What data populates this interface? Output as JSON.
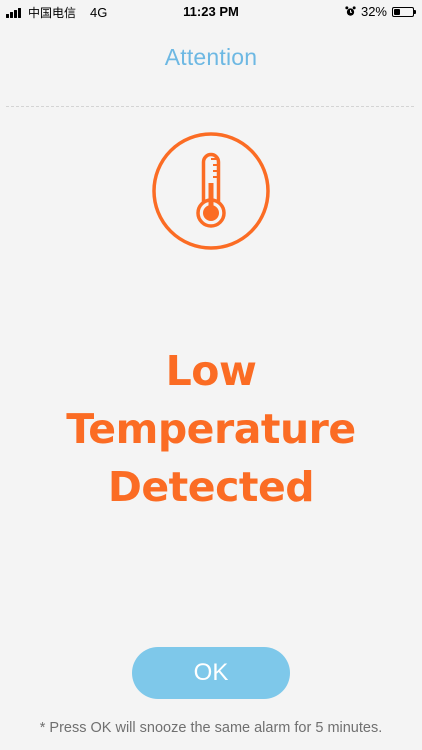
{
  "status_bar": {
    "carrier": "中国电信",
    "network": "4G",
    "time": "11:23 PM",
    "battery_percent": "32%",
    "battery_level": 0.32
  },
  "header": {
    "title": "Attention"
  },
  "alert": {
    "icon": "thermometer-icon",
    "line1": "Low",
    "line2": "Temperature",
    "line3": "Detected"
  },
  "actions": {
    "ok_label": "OK"
  },
  "footnote": "* Press OK will snooze the same alarm for 5 minutes.",
  "colors": {
    "accent_blue": "#6db8e3",
    "button_blue": "#7ec8ea",
    "alert_orange": "#fb6c24",
    "background": "#f4f4f4"
  }
}
